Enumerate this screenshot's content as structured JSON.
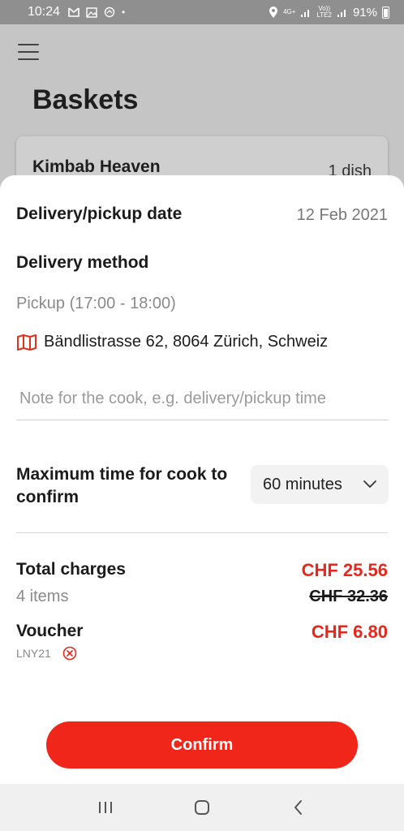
{
  "status_bar": {
    "time": "10:24",
    "network_top": "4G+",
    "volte": "Vo))",
    "lte": "LTE2",
    "battery": "91%",
    "icons": [
      "gmail-icon",
      "image-icon",
      "sync-icon",
      "dot-icon",
      "location-icon",
      "signal-icon",
      "battery-icon"
    ]
  },
  "background_page": {
    "title": "Baskets",
    "card": {
      "name": "Kimbab Heaven",
      "count": "1 dish"
    }
  },
  "sheet": {
    "date_label": "Delivery/pickup date",
    "date_value": "12 Feb 2021",
    "method_label": "Delivery method",
    "method_value": "Pickup (17:00 - 18:00)",
    "address": "Bändlistrasse 62, 8064 Zürich, Schweiz",
    "note_placeholder": "Note for the cook, e.g. delivery/pickup time",
    "note_value": "",
    "confirm_time_label": "Maximum time for cook to confirm",
    "confirm_time_value": "60 minutes",
    "total_label": "Total charges",
    "total_price": "CHF 25.56",
    "items_count": "4 items",
    "original_price": "CHF 32.36",
    "voucher_label": "Voucher",
    "voucher_code": "LNY21",
    "voucher_amount": "CHF 6.80",
    "confirm_button": "Confirm"
  },
  "colors": {
    "accent_red": "#f0261a",
    "price_red": "#e8261b",
    "map_icon_red": "#e0301e"
  }
}
